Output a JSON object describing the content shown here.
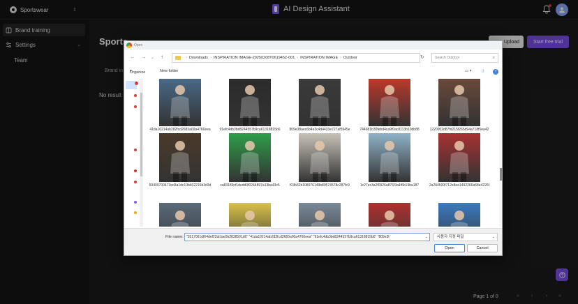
{
  "workspace": {
    "name": "Sportswear"
  },
  "app": {
    "title": "AI Design Assistant"
  },
  "sidebar": {
    "items": [
      {
        "label": "Brand training",
        "icon": "book-icon"
      },
      {
        "label": "Settings",
        "icon": "sliders-icon"
      },
      {
        "label": "Team",
        "icon": ""
      }
    ]
  },
  "main": {
    "title": "Sports",
    "tab_partial": "Brand in",
    "no_results": "No result",
    "upload_label": "Upload",
    "trial_label": "Start free trial",
    "pager": "Page 1 of 0"
  },
  "dialog": {
    "title": "Open",
    "path": [
      "Downloads",
      "INSPIRATION IMAGE-20250208T061945Z-001",
      "INSPIRATION IMAGE",
      "Outdoor"
    ],
    "search_placeholder": "Search Outdoor",
    "organize_label": "Organize",
    "new_folder_label": "New folder",
    "files": [
      {
        "name": "41da16214ab282fcd2683a00a4766eea",
        "bg": "#4a6b8a"
      },
      {
        "name": "91efc4db3bd8244557b9ca61318815b6",
        "bg": "#2b2b2b"
      },
      {
        "name": "809e38aec6b4e3c4d4433e727af5945e",
        "bg": "#3a3a3a"
      },
      {
        "name": "744681b30febd4ca9f0ac8113b10db88",
        "bg": "#c0392b"
      },
      {
        "name": "1220902d87fd215f265d94a718f5ea42",
        "bg": "#6b4a3a"
      },
      {
        "name": "50409700473ed3a1dc10b402216b3d3d",
        "bg": "#4a3a2a"
      },
      {
        "name": "ca83189cf1dedd3f0244897a13ba43c5",
        "bg": "#2e9e4a"
      },
      {
        "name": "f03b32b108976149b80574578c287fc9",
        "bg": "#c8c2b8"
      },
      {
        "name": "1c27ec3a2f0926a876f3a4f6b19ba187",
        "bg": "#8fb3c9"
      },
      {
        "name": "2a204500f712e8ee1492266a58e4226f",
        "bg": "#a83232"
      },
      {
        "name": "",
        "bg": "#5b6b7b"
      },
      {
        "name": "",
        "bg": "#d9c24a"
      },
      {
        "name": "",
        "bg": "#7a8a9a"
      },
      {
        "name": "",
        "bg": "#b03030"
      },
      {
        "name": "",
        "bg": "#3a7ac0"
      }
    ],
    "file_name_label": "File name:",
    "file_name_value": "\"3517061df64def22dcfae5b2838591d6\" \"41da16214ab282fcd2683a00a4766eea\" \"91efc4db3bd8244557b9ca61318815b6\" \"809e3ł",
    "file_type": "사용자 지정 파일",
    "open_label": "Open",
    "cancel_label": "Cancel"
  }
}
